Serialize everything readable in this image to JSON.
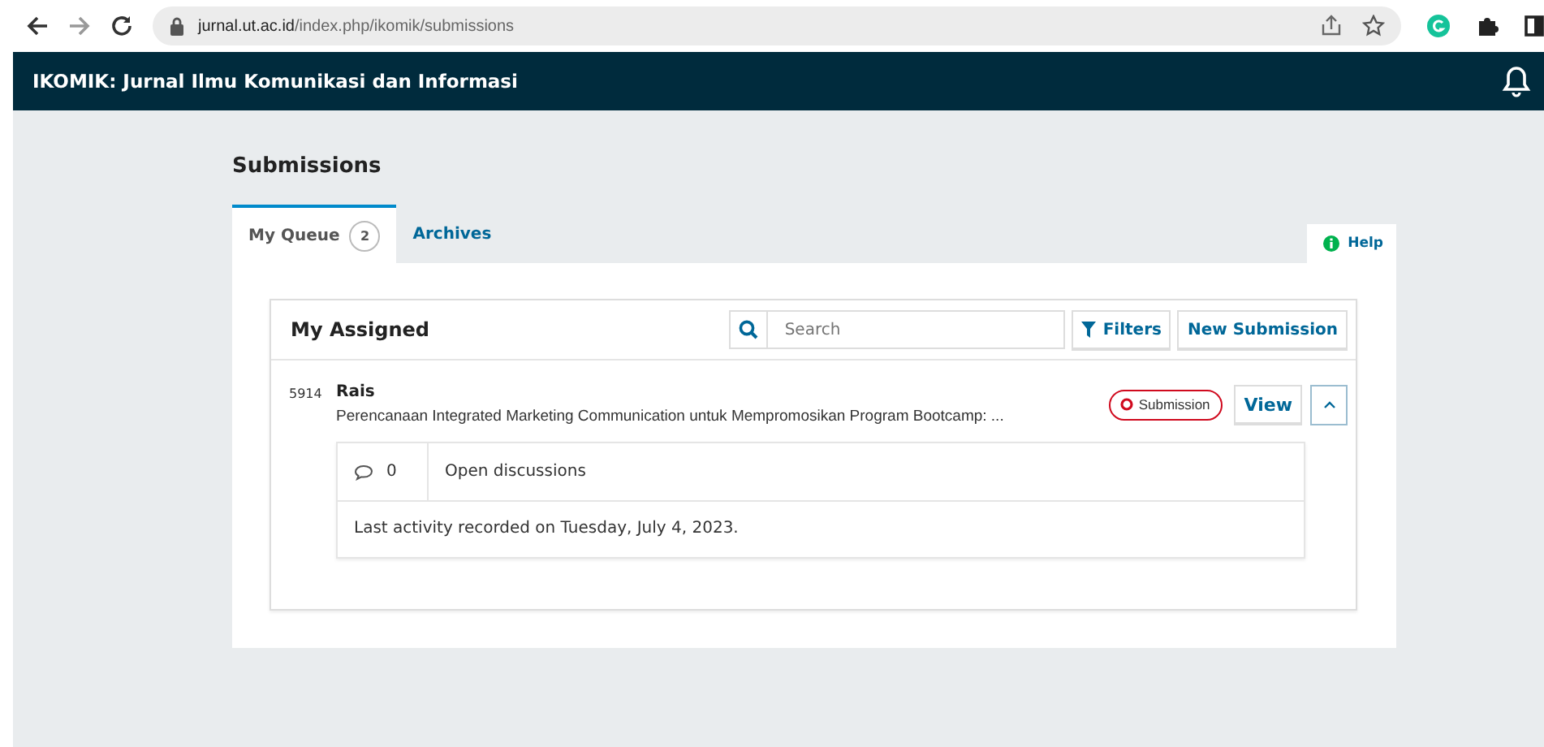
{
  "browser": {
    "url_host": "jurnal.ut.ac.id",
    "url_path": "/index.php/ikomik/submissions"
  },
  "header": {
    "title": "IKOMIK: Jurnal Ilmu Komunikasi dan Informasi"
  },
  "page_title": "Submissions",
  "tabs": [
    {
      "label": "My Queue",
      "count": "2",
      "selected": true
    },
    {
      "label": "Archives",
      "selected": false
    }
  ],
  "help": "Help",
  "list": {
    "title": "My Assigned",
    "search": {
      "placeholder": "Search"
    },
    "filters": "Filters",
    "new_button": "New Submission",
    "items": [
      {
        "id": "5914",
        "author": "Rais",
        "title": "Perencanaan Integrated Marketing Communication untuk Mempromosikan Program Bootcamp: ...",
        "stage": "Submission",
        "view": "View",
        "expanded": true,
        "discussions": "0",
        "discussions_label": "Open discussions",
        "activity": "Last activity recorded on Tuesday, July 4, 2023."
      }
    ]
  }
}
